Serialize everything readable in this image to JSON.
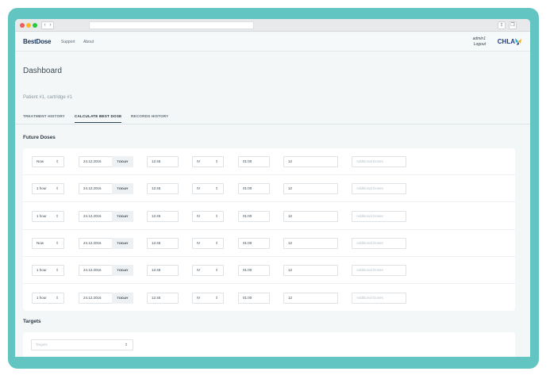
{
  "browser": {
    "nav_back": "‹",
    "nav_forward": "›"
  },
  "header": {
    "logo_main": "BestDose",
    "logo_accent": "",
    "nav": [
      "Support",
      "About"
    ],
    "user_name": "admin1",
    "logout_label": "Logout",
    "brand_right": "CHLA"
  },
  "page": {
    "title": "Dashboard",
    "patient_label": "Patient #1, cartridge #1"
  },
  "tabs": [
    {
      "label": "TREATMENT HISTORY",
      "active": false
    },
    {
      "label": "CALCULATE BEST DOSE",
      "active": true
    },
    {
      "label": "RECORDS HISTORY",
      "active": false
    }
  ],
  "future_doses": {
    "label": "Future Doses",
    "today_label": "TODAY",
    "additional_placeholder": "Additional Doses",
    "rows": [
      {
        "when": "Now",
        "date": "24.12.2016",
        "time": "12:45",
        "route": "IV",
        "duration": "01:00",
        "amount": "12"
      },
      {
        "when": "1 hour",
        "date": "24.12.2016",
        "time": "12:45",
        "route": "IV",
        "duration": "01:00",
        "amount": "12"
      },
      {
        "when": "1 hour",
        "date": "24.12.2016",
        "time": "12:45",
        "route": "IV",
        "duration": "01:00",
        "amount": "12"
      },
      {
        "when": "Now",
        "date": "24.12.2016",
        "time": "12:45",
        "route": "IV",
        "duration": "01:00",
        "amount": "12"
      },
      {
        "when": "1 hour",
        "date": "24.12.2016",
        "time": "12:45",
        "route": "IV",
        "duration": "01:00",
        "amount": "12"
      },
      {
        "when": "1 hour",
        "date": "24.12.2016",
        "time": "12:45",
        "route": "IV",
        "duration": "01:00",
        "amount": "12"
      }
    ]
  },
  "targets": {
    "label": "Targets",
    "select_placeholder": "Targets"
  },
  "colors": {
    "frame": "#63c5c2",
    "background": "#f3f7f8",
    "logo_accent": "#e8792d",
    "brand_blue": "#1d3f8a"
  }
}
